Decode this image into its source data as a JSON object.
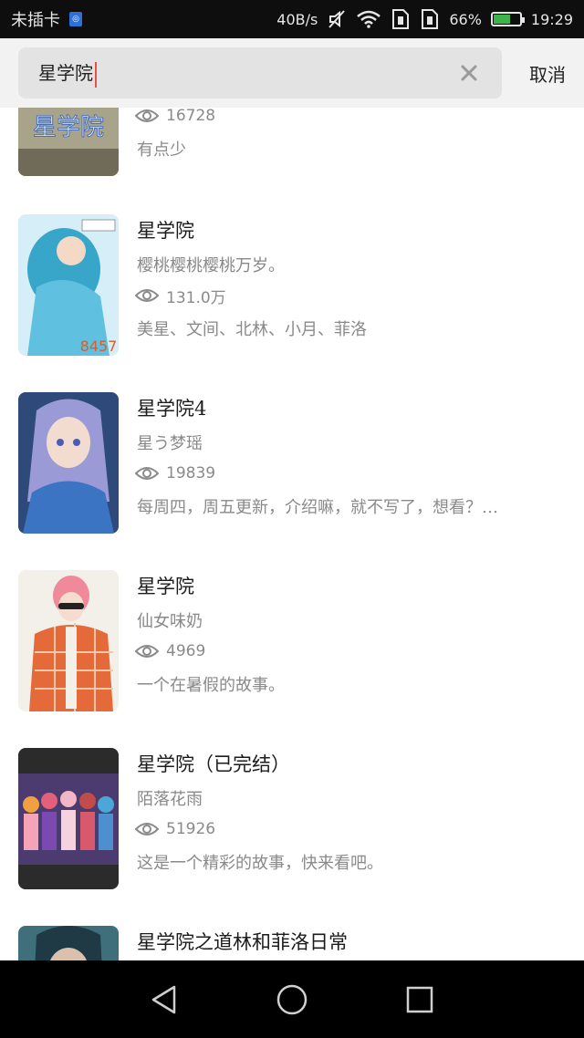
{
  "status_bar": {
    "carrier": "未插卡",
    "network_speed": "40B/s",
    "battery": "66%",
    "battery_level": 0.66,
    "time": "19:29"
  },
  "search": {
    "query": "星学院",
    "cancel_label": "取消"
  },
  "results": [
    {
      "title": "",
      "author": "",
      "views": "16728",
      "description": "有点少",
      "cover_icon": "cover-xingxueyuan-logo"
    },
    {
      "title": "星学院",
      "author": "樱桃樱桃樱桃万岁。",
      "views": "131.0万",
      "description": "美星、文间、北林、小月、菲洛",
      "cover_icon": "cover-blue-haired-girl"
    },
    {
      "title": "星学院4",
      "author": "星う梦瑶",
      "views": "19839",
      "description": "每周四，周五更新，介绍嘛，就不写了，想看？…",
      "cover_icon": "cover-anime-girl-purple"
    },
    {
      "title": "星学院",
      "author": "仙女味奶",
      "views": "4969",
      "description": "一个在暑假的故事。",
      "cover_icon": "cover-plaid-suit-character"
    },
    {
      "title": "星学院（已完结）",
      "author": "陌落花雨",
      "views": "51926",
      "description": "这是一个精彩的故事，快来看吧。",
      "cover_icon": "cover-group-of-girls"
    },
    {
      "title": "星学院之道林和菲洛日常",
      "author": "",
      "views": "",
      "description": "",
      "cover_icon": "cover-dark-haired-boy"
    }
  ],
  "nav": {
    "back_icon": "back-triangle-icon",
    "home_icon": "home-circle-icon",
    "recents_icon": "recents-square-icon"
  }
}
